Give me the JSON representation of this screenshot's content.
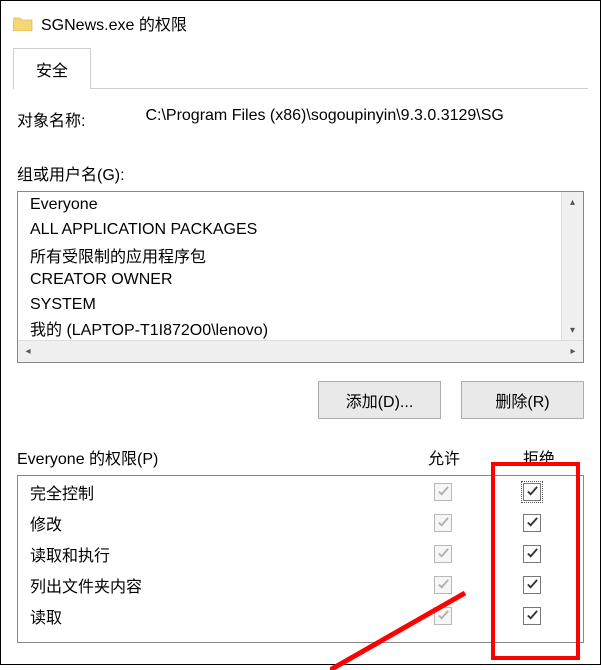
{
  "window": {
    "title": "SGNews.exe 的权限"
  },
  "tabs": {
    "security": "安全"
  },
  "object": {
    "label": "对象名称:",
    "path": "C:\\Program Files (x86)\\sogoupinyin\\9.3.0.3129\\SG"
  },
  "groups": {
    "label": "组或用户名(G):",
    "items": [
      {
        "name": "Everyone",
        "icon": "people"
      },
      {
        "name": "ALL APPLICATION PACKAGES",
        "icon": "monitor"
      },
      {
        "name": "所有受限制的应用程序包",
        "icon": "monitor"
      },
      {
        "name": "CREATOR OWNER",
        "icon": "people"
      },
      {
        "name": "SYSTEM",
        "icon": "people"
      },
      {
        "name": "我的 (LAPTOP-T1I872O0\\lenovo)",
        "icon": "person"
      }
    ]
  },
  "buttons": {
    "add": "添加(D)...",
    "remove": "删除(R)"
  },
  "perm_header": {
    "title": "Everyone 的权限(P)",
    "allow": "允许",
    "deny": "拒绝"
  },
  "permissions": [
    {
      "name": "完全控制",
      "allow": true,
      "deny": true,
      "deny_focus": true
    },
    {
      "name": "修改",
      "allow": true,
      "deny": true
    },
    {
      "name": "读取和执行",
      "allow": true,
      "deny": true
    },
    {
      "name": "列出文件夹内容",
      "allow": true,
      "deny": true
    },
    {
      "name": "读取",
      "allow": true,
      "deny": true
    }
  ]
}
